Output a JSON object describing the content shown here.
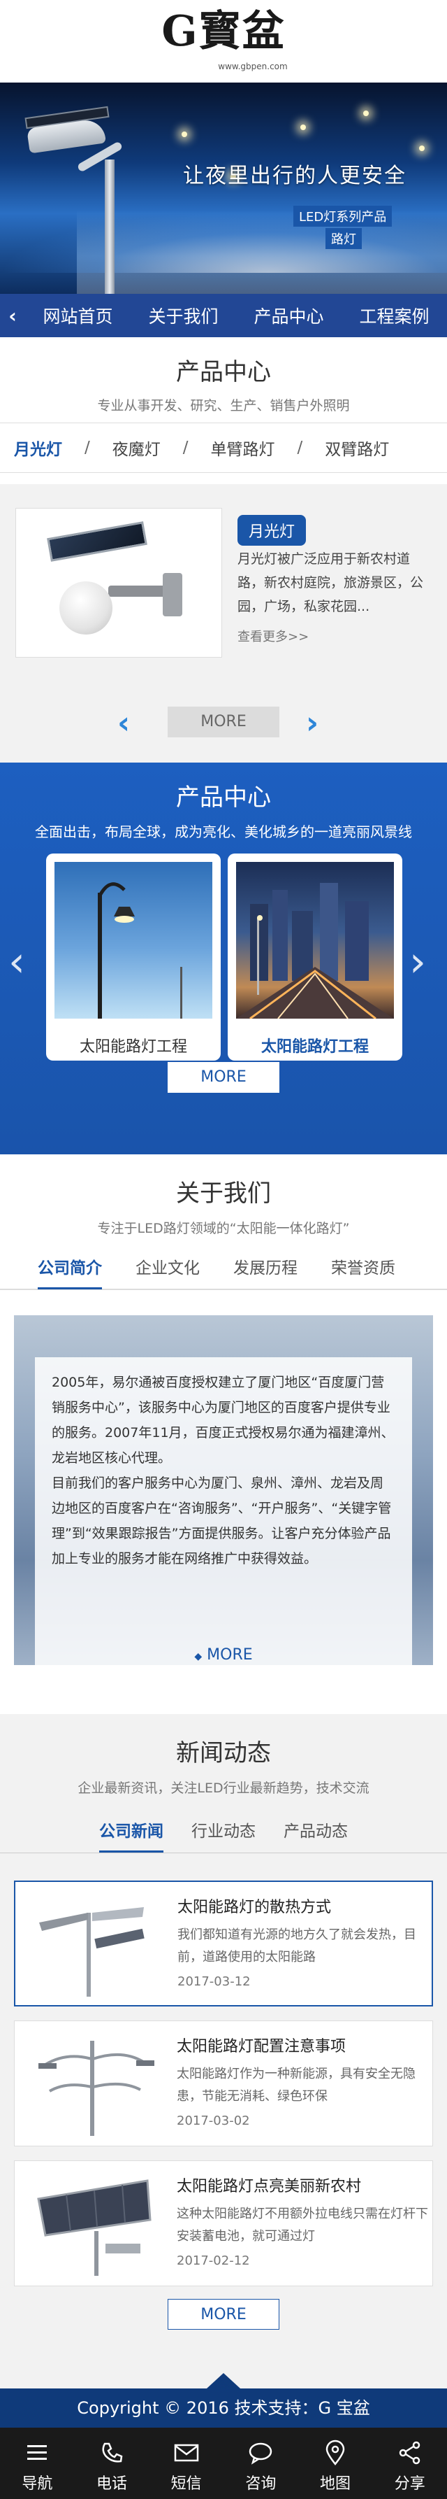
{
  "header": {
    "logo_text": "G寳盆",
    "url": "www.gbpen.com"
  },
  "banner": {
    "headline": "让夜里出行的人更安全",
    "subline1": "LED灯系列产品",
    "subline2": "路灯"
  },
  "nav": {
    "items": [
      "网站首页",
      "关于我们",
      "产品中心",
      "工程案例"
    ]
  },
  "products1": {
    "title": "产品中心",
    "subtitle": "专业从事开发、研究、生产、销售户外照明",
    "tabs": [
      "月光灯",
      "夜魔灯",
      "单臂路灯",
      "双臂路灯"
    ],
    "card": {
      "tag": "月光灯",
      "desc": "月光灯被广泛应用于新农村道路，新农村庭院，旅游景区，公园，广场，私家花园...",
      "more": "查看更多>>"
    },
    "more_button": "MORE"
  },
  "products2": {
    "title": "产品中心",
    "subtitle": "全面出击，布局全球，成为亮化、美化城乡的一道亮丽风景线",
    "cards": [
      {
        "caption": "太阳能路灯工程"
      },
      {
        "caption": "太阳能路灯工程"
      }
    ],
    "more_button": "MORE"
  },
  "about": {
    "title": "关于我们",
    "subtitle": "专注于LED路灯领域的“太阳能一体化路灯”",
    "tabs": [
      "公司简介",
      "企业文化",
      "发展历程",
      "荣誉资质"
    ],
    "paragraph1": "2005年，易尔通被百度授权建立了厦门地区“百度厦门营销服务中心”，该服务中心为厦门地区的百度客户提供专业的服务。2007年11月，百度正式授权易尔通为福建漳州、龙岩地区核心代理。",
    "paragraph2": "目前我们的客户服务中心为厦门、泉州、漳州、龙岩及周边地区的百度客户在“咨询服务”、“开户服务”、“关键字管理”到“效果跟踪报告”方面提供服务。让客户充分体验产品加上专业的服务才能在网络推广中获得效益。",
    "more": "MORE"
  },
  "news": {
    "title": "新闻动态",
    "subtitle": "企业最新资讯，关注LED行业最新趋势，技术交流",
    "tabs": [
      "公司新闻",
      "行业动态",
      "产品动态"
    ],
    "items": [
      {
        "title": "太阳能路灯的散热方式",
        "summary": "我们都知道有光源的地方久了就会发热，目前，道路使用的太阳能路",
        "date": "2017-03-12"
      },
      {
        "title": "太阳能路灯配置注意事项",
        "summary": "太阳能路灯作为一种新能源，具有安全无隐患，节能无消耗、绿色环保",
        "date": "2017-03-02"
      },
      {
        "title": "太阳能路灯点亮美丽新农村",
        "summary": "这种太阳能路灯不用额外拉电线只需在灯杆下安装蓄电池，就可通过灯",
        "date": "2017-02-12"
      }
    ],
    "more_button": "MORE"
  },
  "footer": {
    "copyright": "Copyright © 2016  技术支持：G 宝盆"
  },
  "bottom_bar": {
    "items": [
      {
        "label": "导航",
        "icon": "menu-icon"
      },
      {
        "label": "电话",
        "icon": "phone-icon"
      },
      {
        "label": "短信",
        "icon": "mail-icon"
      },
      {
        "label": "咨询",
        "icon": "chat-icon"
      },
      {
        "label": "地图",
        "icon": "map-pin-icon"
      },
      {
        "label": "分享",
        "icon": "share-icon"
      }
    ]
  },
  "colors": {
    "brand_blue": "#1a56a8",
    "dark_blue": "#0f3a7a",
    "accent_light_blue": "#2e86d8",
    "bottom_bar": "#1a1a1a"
  }
}
